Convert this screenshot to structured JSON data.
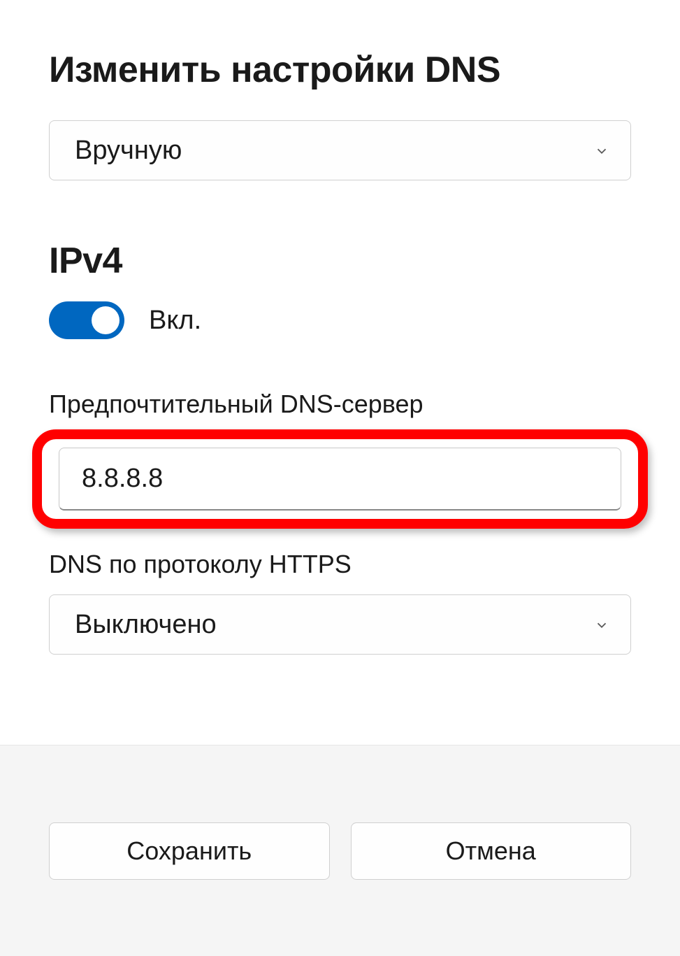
{
  "dialog": {
    "title": "Изменить настройки DNS",
    "mode_dropdown": {
      "selected": "Вручную"
    }
  },
  "ipv4": {
    "heading": "IPv4",
    "toggle_label": "Вкл.",
    "preferred_dns": {
      "label": "Предпочтительный DNS-сервер",
      "value": "8.8.8.8"
    },
    "dns_over_https": {
      "label": "DNS по протоколу HTTPS",
      "selected": "Выключено"
    }
  },
  "footer": {
    "save_label": "Сохранить",
    "cancel_label": "Отмена"
  }
}
